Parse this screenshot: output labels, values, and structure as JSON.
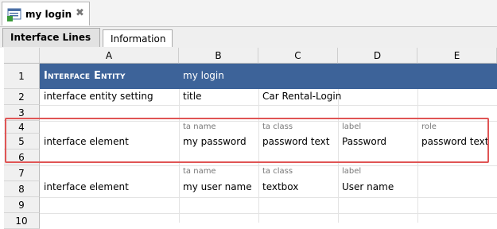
{
  "doc_tab": {
    "title": "my login",
    "close_symbol": "✖",
    "icon": "interface-entity-icon"
  },
  "sub_tabs": [
    {
      "label": "Interface Lines"
    },
    {
      "label": "Information"
    }
  ],
  "columns": [
    "A",
    "B",
    "C",
    "D",
    "E"
  ],
  "rows": [
    "1",
    "2",
    "3",
    "4",
    "5",
    "6",
    "7",
    "8",
    "9",
    "10"
  ],
  "cells": {
    "r1a": "Interface Entity",
    "r1b": "my login",
    "r2a": "interface entity setting",
    "r2b": "title",
    "r2c": "Car Rental-Login",
    "r4b": "ta name",
    "r4c": "ta class",
    "r4d": "label",
    "r4e": "role",
    "r5a": "interface element",
    "r5b": "my password",
    "r5c": "password text",
    "r5d": "Password",
    "r5e": "password text",
    "r7b": "ta name",
    "r7c": "ta class",
    "r7d": "label",
    "r8a": "interface element",
    "r8b": "my user name",
    "r8c": "textbox",
    "r8d": "User name"
  },
  "colors": {
    "header_row": "#3d6399",
    "highlight": "#e05555"
  }
}
